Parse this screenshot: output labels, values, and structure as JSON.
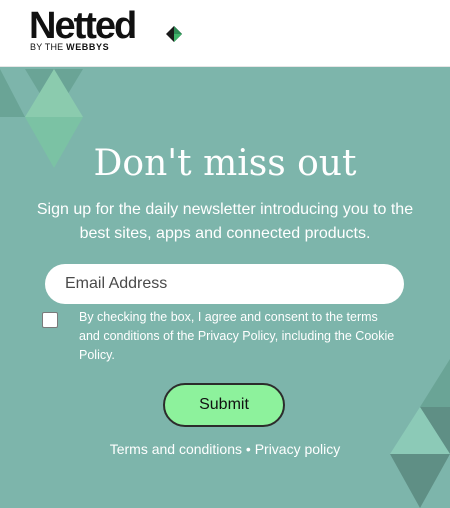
{
  "brand": {
    "name": "Netted",
    "tagline_prefix": "BY THE",
    "tagline_brand": "WEBBYS"
  },
  "hero": {
    "title": "Don't miss out",
    "subtitle": "Sign up for the daily newsletter introducing you to the best sites, apps and connected products.",
    "email_placeholder": "Email Address",
    "consent_text": "By checking the box, I agree and consent to the terms and conditions of the Privacy Policy, including the Cookie Policy.",
    "consent_checked": false,
    "submit_label": "Submit"
  },
  "footer": {
    "terms_label": "Terms and conditions",
    "separator": "•",
    "privacy_label": "Privacy policy"
  },
  "colors": {
    "hero_background": "#7db5ab",
    "submit_background": "#8df29c",
    "logo_mark": [
      "#1a1a1a",
      "#3fb36a"
    ]
  }
}
